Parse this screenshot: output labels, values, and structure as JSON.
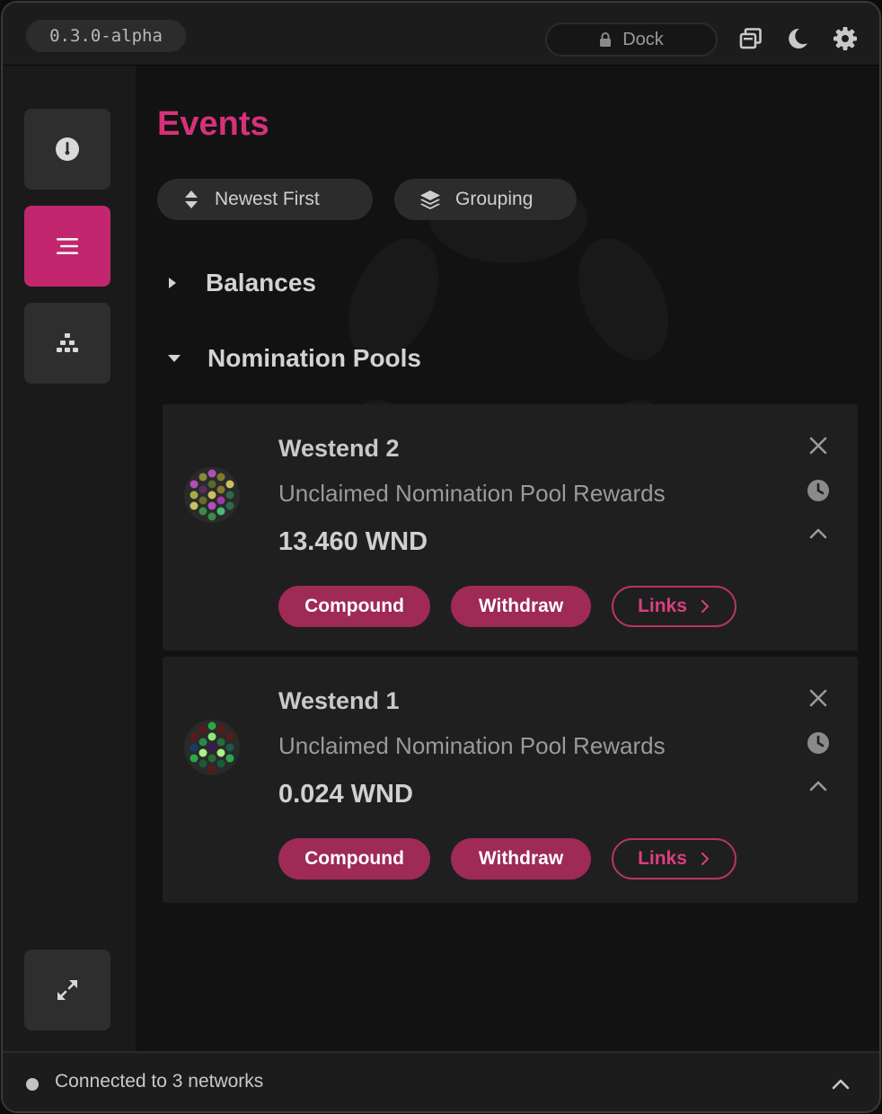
{
  "header": {
    "version": "0.3.0-alpha",
    "dock_label": "Dock"
  },
  "main": {
    "title": "Events",
    "sort_label": "Newest First",
    "grouping_label": "Grouping",
    "sections": [
      {
        "label": "Balances",
        "expanded": false
      },
      {
        "label": "Nomination Pools",
        "expanded": true
      }
    ],
    "events": [
      {
        "title": "Westend 2",
        "subtitle": "Unclaimed Nomination Pool Rewards",
        "amount": "13.460 WND",
        "actions": {
          "compound": "Compound",
          "withdraw": "Withdraw",
          "links": "Links"
        }
      },
      {
        "title": "Westend 1",
        "subtitle": "Unclaimed Nomination Pool Rewards",
        "amount": "0.024 WND",
        "actions": {
          "compound": "Compound",
          "withdraw": "Withdraw",
          "links": "Links"
        }
      }
    ]
  },
  "footer": {
    "status": "Connected to 3 networks"
  },
  "colors": {
    "accent": "#d6317a",
    "active_tab": "#c2266e",
    "button_fill": "#9e2a55"
  },
  "icons": [
    "lock-icon",
    "copy-windows-icon",
    "moon-icon",
    "gear-icon",
    "gauge-icon",
    "list-icon",
    "hierarchy-icon",
    "expand-icon",
    "sort-icon",
    "layers-icon",
    "caret-right-icon",
    "caret-down-icon",
    "close-icon",
    "clock-icon",
    "chevron-up-icon",
    "chevron-right-icon"
  ]
}
